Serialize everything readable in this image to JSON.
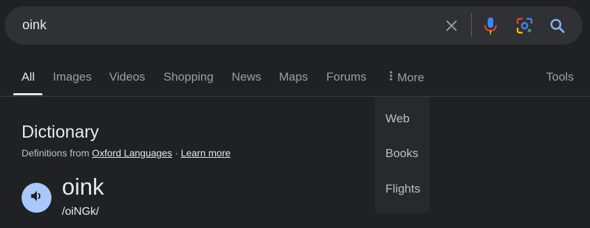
{
  "search": {
    "query": "oink",
    "icons": [
      "clear-icon",
      "mic-icon",
      "lens-icon",
      "search-icon"
    ]
  },
  "tabs": [
    {
      "label": "All",
      "active": true
    },
    {
      "label": "Images"
    },
    {
      "label": "Videos"
    },
    {
      "label": "Shopping"
    },
    {
      "label": "News"
    },
    {
      "label": "Maps"
    },
    {
      "label": "Forums"
    }
  ],
  "more": {
    "label": "More",
    "icon": "more-vert-icon"
  },
  "tools": {
    "label": "Tools"
  },
  "dropdown": {
    "items": [
      "Web",
      "Books",
      "Flights"
    ]
  },
  "dictionary": {
    "title": "Dictionary",
    "defs_prefix": "Definitions from",
    "source": "Oxford Languages",
    "separator": "·",
    "learn_more": "Learn more",
    "word": "oink",
    "phonetic": "/oiNGk/"
  },
  "colors": {
    "background": "#202124",
    "search_bar": "#303134",
    "speaker_button": "#a8c7fa",
    "mic_blue": "#4285f4",
    "mic_red": "#ea4335",
    "search_icon": "#8ab4f8"
  }
}
